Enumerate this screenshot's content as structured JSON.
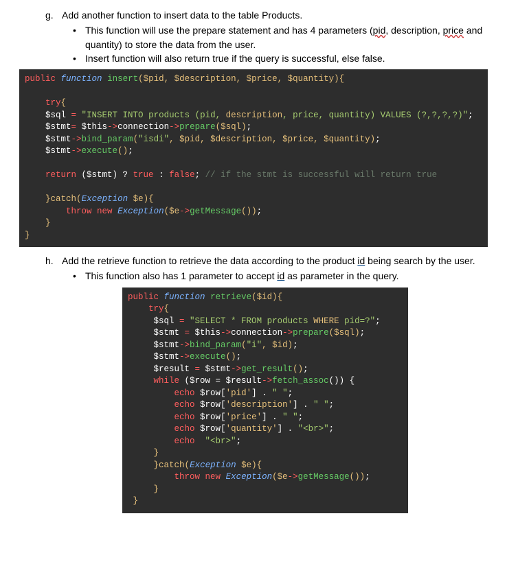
{
  "g": {
    "letter": "g.",
    "title": "Add another function to insert data to the table Products.",
    "bullets": [
      {
        "pre": "This function will use the prepare statement and has 4 parameters (",
        "u1": "pid",
        "mid1": ", description, ",
        "u2": "price",
        "mid2": " and quantity) to store the data from the user."
      },
      {
        "pre": "Insert function will also return true if the query is successful, else false."
      }
    ]
  },
  "code1": {
    "public": "public",
    "function": "function",
    "name": "insert",
    "params": "($pid, $description, $price, $quantity)",
    "try": "try",
    "l1_var": "$sql",
    "l1_eq": " = ",
    "l1_str_a": "\"INSERT INTO products (pid, ",
    "l1_str_b": "description",
    "l1_str_c": ", price, quantity) VALUES (?,?,?,?)\"",
    "l2_var": "$stmt",
    "l2_eq": "= ",
    "l2_this": "$this",
    "l2_conn": "connection",
    "l2_prep": "prepare",
    "l2_arg": "($sql)",
    "l3_var": "$stmt",
    "l3_bind": "bind_param",
    "l3_arg_a": "(",
    "l3_str": "\"isdi\"",
    "l3_arg_b": ", $pid, $description, $price, $quantity)",
    "l4_var": "$stmt",
    "l4_exec": "execute",
    "l4_arg": "()",
    "ret": "return",
    "ret_a": " ($stmt) ? ",
    "ret_t": "true",
    "ret_b": " : ",
    "ret_f": "false",
    "ret_c": ";",
    "comment": " // if the stmt is successful will return true",
    "catch_kw": "catch",
    "catch_arg_a": "(",
    "catch_cls": "Exception",
    "catch_arg_b": " $e)",
    "throw": "throw",
    "new": "new",
    "exc": "Exception",
    "exc_arg_a": "($e",
    "exc_gm": "getMessage",
    "exc_arg_b": "())"
  },
  "h": {
    "letter": "h.",
    "title_a": "Add the retrieve function to retrieve the data according to the product ",
    "title_u": "id",
    "title_b": " being search by the user.",
    "bullets": [
      {
        "pre": "This function also has 1 parameter to accept ",
        "u1": "id",
        "post": " as parameter in the query."
      }
    ]
  },
  "code2": {
    "public": "public",
    "function": "function",
    "name": "retrieve",
    "params": "($id)",
    "try": "try",
    "s1_var": "$sql",
    "s1_eq": " = ",
    "s1_str_a": "\"SELECT * FROM products ",
    "s1_str_b": "WHERE",
    "s1_str_c": " pid=?\"",
    "s2_var": "$stmt",
    "s2_eq": " = ",
    "s2_this": "$this",
    "s2_conn": "connection",
    "s2_prep": "prepare",
    "s2_arg": "($sql)",
    "s3_var": "$stmt",
    "s3_bind": "bind_param",
    "s3_arg_a": "(",
    "s3_str": "\"i\"",
    "s3_arg_b": ", $id)",
    "s4_var": "$stmt",
    "s4_exec": "execute",
    "s4_arg": "()",
    "s5_var": "$result",
    "s5_eq": " = ",
    "s5_stmt": "$stmt",
    "s5_gr": "get_result",
    "s5_arg": "()",
    "while": "while",
    "w_a": " ($row = $result",
    "w_fa": "fetch_assoc",
    "w_b": "()) {",
    "echo": "echo",
    "row": "$row",
    "idx_pid": "'pid'",
    "idx_desc": "'description'",
    "idx_price": "'price'",
    "idx_qty": "'quantity'",
    "sp": "\" \"",
    "br": "\"<br>\"",
    "catch_kw": "catch",
    "catch_cls": "Exception",
    "catch_var": " $e",
    "throw": "throw",
    "new": "new",
    "exc": "Exception",
    "exc_gm": "getMessage"
  }
}
